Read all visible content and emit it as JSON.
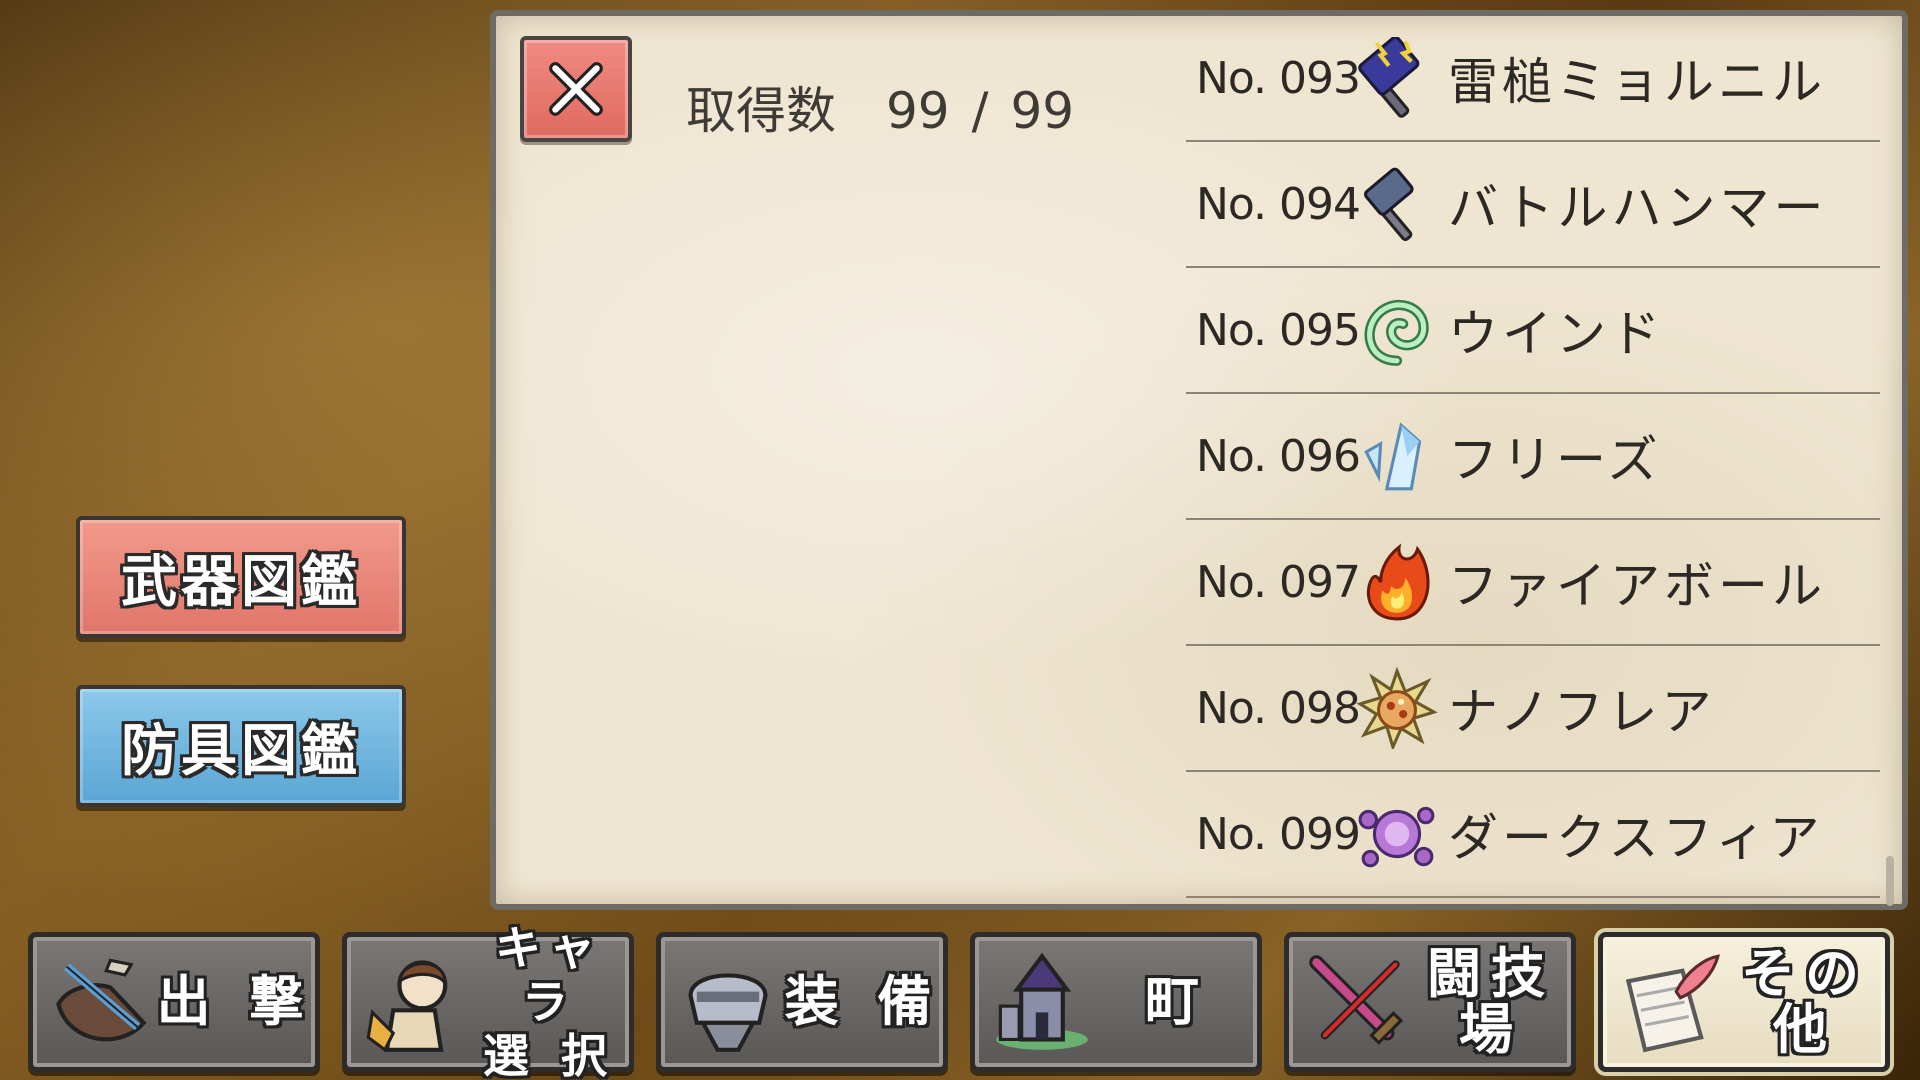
{
  "left_buttons": {
    "weapon_catalog": "武器図鑑",
    "armor_catalog": "防具図鑑"
  },
  "header": {
    "count_label": "取得数",
    "count_owned": "99",
    "count_separator": "/",
    "count_total": "99"
  },
  "items": [
    {
      "no": "No. 093",
      "name": "雷槌ミョルニル",
      "icon": "mjolnir-hammer-icon"
    },
    {
      "no": "No. 094",
      "name": "バトルハンマー",
      "icon": "battle-hammer-icon"
    },
    {
      "no": "No. 095",
      "name": "ウインド",
      "icon": "wind-swirl-icon"
    },
    {
      "no": "No. 096",
      "name": "フリーズ",
      "icon": "ice-crystal-icon"
    },
    {
      "no": "No. 097",
      "name": "ファイアボール",
      "icon": "fireball-icon"
    },
    {
      "no": "No. 098",
      "name": "ナノフレア",
      "icon": "nanoflare-burst-icon"
    },
    {
      "no": "No. 099",
      "name": "ダークスフィア",
      "icon": "dark-sphere-icon"
    }
  ],
  "nav": {
    "sortie": "出 撃",
    "character_line1": "キャラ",
    "character_line2": "選 択",
    "equipment": "装 備",
    "town": "町",
    "arena": "闘技場",
    "other": "その他"
  },
  "colors": {
    "weapon_button": "#e0766a",
    "armor_button": "#5aa6d4",
    "close_button": "#e06a60",
    "panel": "#efe6d2"
  }
}
